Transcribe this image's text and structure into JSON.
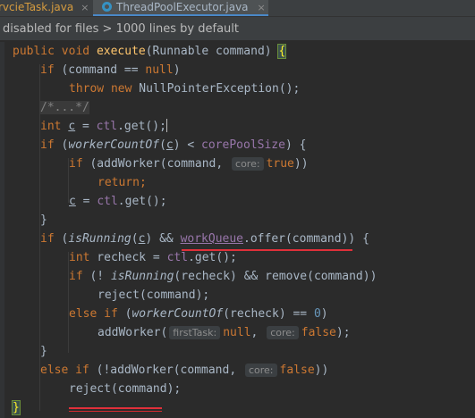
{
  "tabs": [
    {
      "label": "rvcieTask.java",
      "close": "×"
    },
    {
      "label": "ThreadPoolExecutor.java",
      "close": "×",
      "active": true
    }
  ],
  "banner": {
    "text": "disabled for files > 1000 lines by default"
  },
  "code": {
    "l1": {
      "a": "public",
      "b": "void",
      "c": "execute",
      "d": "(Runnable command) ",
      "e": "{"
    },
    "l2": {
      "a": "if",
      "b": " (command == ",
      "c": "null",
      "d": ")"
    },
    "l3": {
      "a": "throw",
      "b": "new",
      "c": " NullPointerException();"
    },
    "l4": {
      "a": "/*...*/"
    },
    "l5": {
      "a": "int",
      "b": "c",
      "c": " = ",
      "d": "ctl",
      "e": ".get();"
    },
    "l6": {
      "a": "if",
      "b": " (",
      "c": "workerCountOf",
      "d": "(",
      "e": "c",
      "f": ") < ",
      "g": "corePoolSize",
      "h": ") {"
    },
    "l7": {
      "a": "if",
      "b": " (addWorker(command, ",
      "hint": "core:",
      "c": "true",
      "d": "))"
    },
    "l8": {
      "a": "return;"
    },
    "l9": {
      "a": "c",
      "b": " = ",
      "c": "ctl",
      "d": ".get();"
    },
    "l10": {
      "a": "}"
    },
    "l11": {
      "a": "if",
      "b": " (",
      "c": "isRunning",
      "d": "(",
      "e": "c",
      "f": ") && ",
      "g": "workQueue",
      "h": ".offer(command)) {"
    },
    "l12": {
      "a": "int",
      "b": " recheck = ",
      "c": "ctl",
      "d": ".get();"
    },
    "l13": {
      "a": "if",
      "b": " (! ",
      "c": "isRunning",
      "d": "(recheck) && remove(command))"
    },
    "l14": {
      "a": "reject(command);"
    },
    "l15": {
      "a": "else if",
      "b": " (",
      "c": "workerCountOf",
      "d": "(recheck) == ",
      "e": "0",
      "f": ")"
    },
    "l16": {
      "a": "addWorker(",
      "hint1": "firstTask:",
      "b": "null",
      "c": ", ",
      "hint2": "core:",
      "d": "false",
      "e": ");"
    },
    "l17": {
      "a": "}"
    },
    "l18": {
      "a": "else if",
      "b": " (!addWorker(command, ",
      "hint": "core:",
      "c": "false",
      "d": "))"
    },
    "l19": {
      "a": "reject(command);"
    },
    "l20": {
      "a": "}"
    }
  },
  "colors": {
    "background": "#2b2b2b",
    "keyword": "#cc7832",
    "method": "#ffc66d",
    "field": "#9876aa",
    "text": "#a9b7c6",
    "annotation_underline": "#e0303a"
  }
}
